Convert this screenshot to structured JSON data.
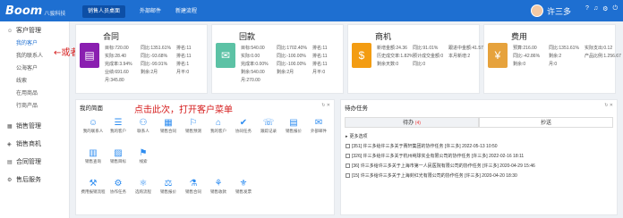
{
  "brand": {
    "logo": "Boom",
    "sub": "八骏科技"
  },
  "nav": {
    "tabs": [
      "销售人员桌面",
      "外部邮件",
      "新建流程"
    ]
  },
  "user": {
    "name": "许三多"
  },
  "sidebar": {
    "groups": [
      {
        "label": "客户管理",
        "items": [
          "我的客户",
          "我的联系人",
          "公海客户",
          "线索",
          "在用商品",
          "行商产品"
        ]
      },
      {
        "label": "销售管理"
      },
      {
        "label": "销售商机"
      },
      {
        "label": "合同管理"
      },
      {
        "label": "售后服务"
      }
    ]
  },
  "annotations": {
    "side": "或者",
    "main": "点击此次，打开客户菜单"
  },
  "cards": [
    {
      "title": "合同",
      "stats": [
        "目标:720.00",
        "同比:1351.61%",
        "排名:11",
        "实际:28.40",
        "同比:-93.68%",
        "排名:11",
        "完成率:3.94%",
        "同比:-99.91%",
        "排名:1",
        "业绩:691.60",
        "剩余:2月",
        "月平:0",
        "月:345.80"
      ],
      "color": "#8a1fb0"
    },
    {
      "title": "回款",
      "stats": [
        "目标:540.00",
        "同比:1702.40%",
        "排名:11",
        "实际:0.00",
        "同比:-100.00%",
        "排名:11",
        "完成率:0.00%",
        "同比:-100.00%",
        "排名:11",
        "剩余:540.00",
        "剩余:2月",
        "月平:0",
        "月:270.00"
      ],
      "color": "#5cc2a5"
    },
    {
      "title": "商机",
      "stats": [
        "新增金额:24.36",
        "同比:91.01%",
        "跟进中金额:41.57",
        "历史成交率:1.82%",
        "预计成交金额:0",
        "本月新增:2",
        "剩余天数:0",
        "同比:0"
      ],
      "color": "#f39c12"
    },
    {
      "title": "费用",
      "stats": [
        "预算:216.00",
        "同比:1351.61%",
        "实际支出:0.12",
        "同比:-42.86%",
        "剩余:2",
        "产品比例:1.256.67",
        "剩余:0",
        "月:0"
      ],
      "color": "#e6a23c"
    }
  ],
  "desk": {
    "title": "我的简面",
    "rows": [
      [
        "我的联系人",
        "我的客户",
        "联系人",
        "销售合同",
        "销售预测",
        "我的客户",
        "协同任务",
        "跟踪记录",
        "销售报价",
        "外部邮件"
      ],
      [
        "销售查询",
        "销售目标",
        "线索"
      ],
      [
        "费用报销流程",
        "协作任务",
        "选购流程",
        "销售报价",
        "销售合同",
        "销售收款",
        "销售发票"
      ]
    ],
    "glyphs": [
      "☺",
      "☰",
      "⚇",
      "▦",
      "⚐",
      "⌂",
      "✔",
      "☏",
      "▤",
      "✉",
      "▥",
      "▨",
      "⚑",
      "⚒",
      "⚙",
      "⚛",
      "⚖",
      "⚗",
      "⚘",
      "⚜"
    ]
  },
  "todo": {
    "title": "待办任务",
    "tab_active": "待办",
    "tab_badge": "(4)",
    "tab_other": "抄送",
    "more": "更多选项",
    "rows": [
      "[351] 许三多给许三多关于赛轩集团的协作任务 [许三多] 2022-05-13 10:50",
      "[326] 许三多给许三多关于杭州纯球实业有限公司的协作任务 [许三多] 2022-02-16 18:11",
      "[36] 许三多给许三多关于上海市第一人民医院有限公司的协作任务 [许三多] 2020-04-29 15:46",
      "[15] 许三多给许三多关于上海封红光有限公司的协作任务 [许三多] 2020-04-20 18:30"
    ]
  }
}
